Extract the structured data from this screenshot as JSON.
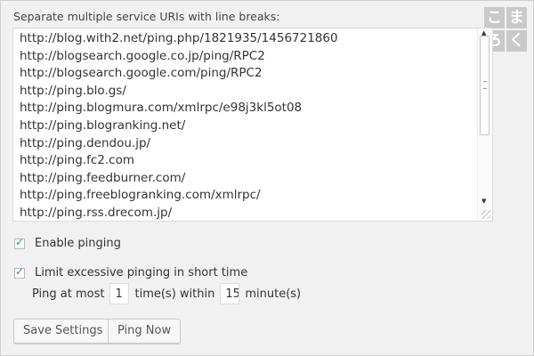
{
  "ping_settings": {
    "caption": "Separate multiple service URIs with line breaks:",
    "urls": [
      "http://blog.with2.net/ping.php/1821935/1456721860",
      "http://blogsearch.google.co.jp/ping/RPC2",
      "http://blogsearch.google.com/ping/RPC2",
      "http://ping.blo.gs/",
      "http://ping.blogmura.com/xmlrpc/e98j3kl5ot08",
      "http://ping.blogranking.net/",
      "http://ping.dendou.jp/",
      "http://ping.fc2.com",
      "http://ping.feedburner.com/",
      "http://ping.freeblogranking.com/xmlrpc/",
      "http://ping.rss.drecom.jp/"
    ],
    "enable_pinging_label": "Enable pinging",
    "enable_pinging_checked": true,
    "limit_label": "Limit excessive pinging in short time",
    "limit_checked": true,
    "ping_at_most_label": "Ping at most",
    "ping_count": "1",
    "times_within_label": "time(s) within",
    "minutes_value": "15",
    "minutes_label": "minute(s)"
  },
  "buttons": {
    "save_label": "Save Settings",
    "ping_now_label": "Ping Now"
  },
  "logo": {
    "chars": [
      "こ",
      "ま",
      "ろ",
      "く"
    ]
  },
  "colors": {
    "background": "#f1f1f1",
    "check_accent": "#1e8cbe",
    "logo_grey": "#c9c9c9"
  }
}
